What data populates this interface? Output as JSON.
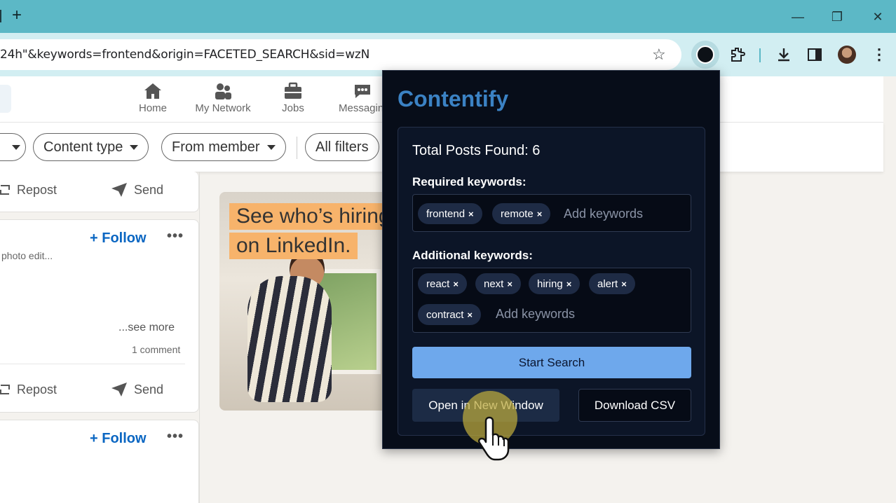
{
  "browser": {
    "url": "24h\"&keywords=frontend&origin=FACETED_SEARCH&sid=wzN",
    "new_tab": "+",
    "window_controls": {
      "minimize": "—",
      "restore": "❐",
      "close": "✕"
    },
    "icons": [
      "new-tab-icon",
      "bookmark-star-icon",
      "contentify-extension-icon",
      "puzzle-extensions-icon",
      "download-icon",
      "side-panel-icon",
      "profile-avatar",
      "menu-kebab-icon"
    ]
  },
  "linkedin": {
    "nav": [
      {
        "label": "Home",
        "icon": "home-icon"
      },
      {
        "label": "My Network",
        "icon": "network-icon"
      },
      {
        "label": "Jobs",
        "icon": "briefcase-icon"
      },
      {
        "label": "Messagin",
        "icon": "messaging-icon"
      }
    ],
    "filters": {
      "content_type": "Content type",
      "from_member": "From member",
      "all_filters": "All filters"
    },
    "post1": {
      "repost": "Repost",
      "send": "Send"
    },
    "post2": {
      "follow": "Follow",
      "snippet": "photo edit...",
      "see_more": "...see more",
      "comments": "1 comment",
      "repost": "Repost",
      "send": "Send"
    },
    "post3": {
      "follow": "Follow"
    },
    "ad": {
      "line1": "See who’s hiring",
      "line2": "on LinkedIn."
    }
  },
  "popup": {
    "title": "Contentify",
    "total_label": "Total Posts Found: 6",
    "required": {
      "label": "Required keywords:",
      "chips": [
        "frontend",
        "remote"
      ],
      "placeholder": "Add keywords"
    },
    "additional": {
      "label": "Additional keywords:",
      "chips": [
        "react",
        "next",
        "hiring",
        "alert",
        "contract"
      ],
      "placeholder": "Add keywords"
    },
    "chip_remove": "×",
    "start_search": "Start Search",
    "open_window": "Open in New Window",
    "download_csv": "Download CSV",
    "colors": {
      "title": "#3b82c4",
      "primary_button": "#6ea8ec",
      "panel_bg": "#0c1527",
      "chip_bg": "#1e2b45"
    }
  }
}
